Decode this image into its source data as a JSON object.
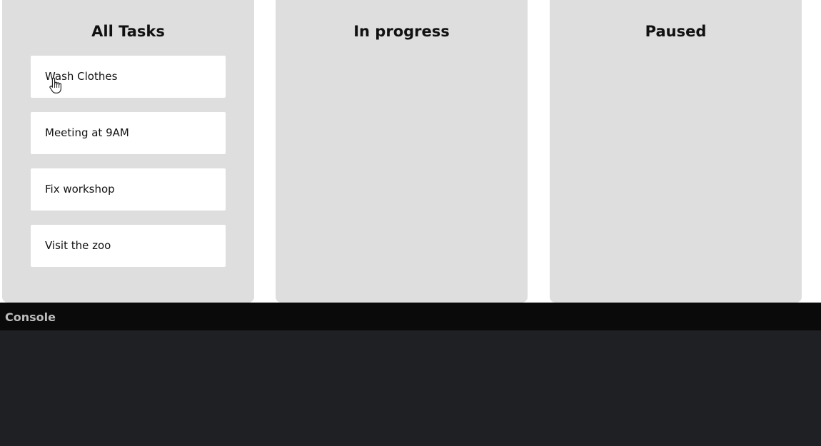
{
  "board": {
    "columns": [
      {
        "title": "All Tasks",
        "cards": [
          {
            "label": "Wash Clothes"
          },
          {
            "label": "Meeting at 9AM"
          },
          {
            "label": "Fix workshop"
          },
          {
            "label": "Visit the zoo"
          }
        ]
      },
      {
        "title": "In progress",
        "cards": []
      },
      {
        "title": "Paused",
        "cards": []
      }
    ]
  },
  "console": {
    "title": "Console"
  },
  "colors": {
    "column_bg": "#dedede",
    "card_bg": "#ffffff",
    "console_bg": "#1f2024",
    "console_header_bg": "#0a0a0a"
  }
}
